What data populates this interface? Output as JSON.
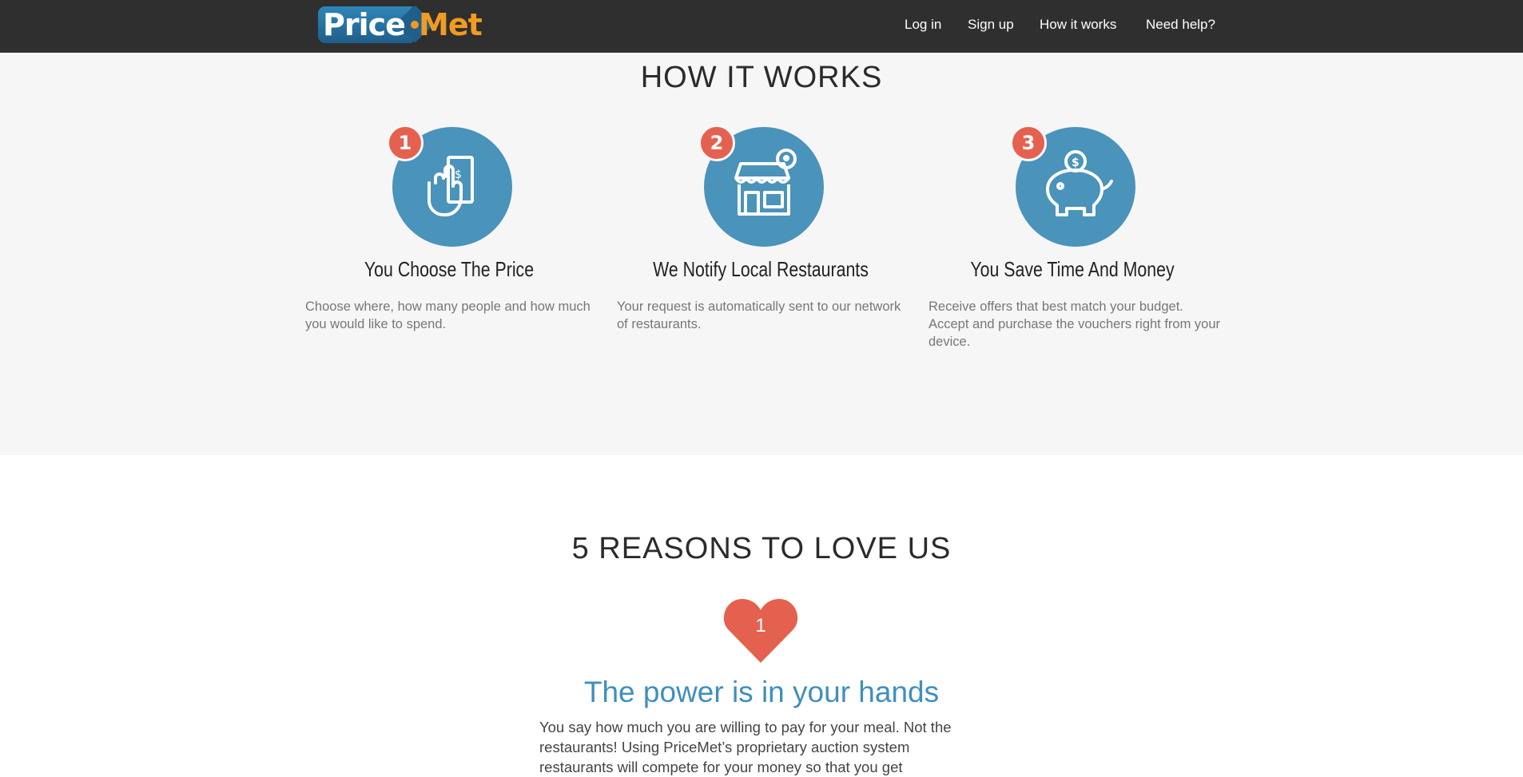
{
  "header": {
    "logo": {
      "part1": "Price",
      "part2": "Met"
    },
    "nav": [
      "Log in",
      "Sign up",
      "How it works",
      "Need help?"
    ]
  },
  "how_it_works": {
    "title": "HOW IT WORKS",
    "steps": [
      {
        "number": "1",
        "icon": "hand-money-icon",
        "title": "You Choose The Price",
        "text": "Choose where, how many people and how much you would like to spend."
      },
      {
        "number": "2",
        "icon": "storefront-icon",
        "title": "We Notify Local Restaurants",
        "text": "Your request is automatically sent to our network of restaurants."
      },
      {
        "number": "3",
        "icon": "piggy-bank-icon",
        "title": "You Save Time And Money",
        "text": "Receive offers that best match your budget. Accept and purchase the vouchers right from your device."
      }
    ]
  },
  "reasons": {
    "title": "5 REASONS TO LOVE US",
    "current": {
      "number": "1",
      "title": "The power is in your hands",
      "text": "You say how much you are willing to pay for your meal. Not the restaurants! Using PriceMet’s proprietary auction system restaurants will compete for your money so that you get"
    }
  },
  "colors": {
    "header_bg": "#2f2f2f",
    "accent_blue": "#4a93bb",
    "badge_red": "#e5614f",
    "logo_orange": "#f29b21",
    "reason_title_blue": "#3f8fbe"
  }
}
